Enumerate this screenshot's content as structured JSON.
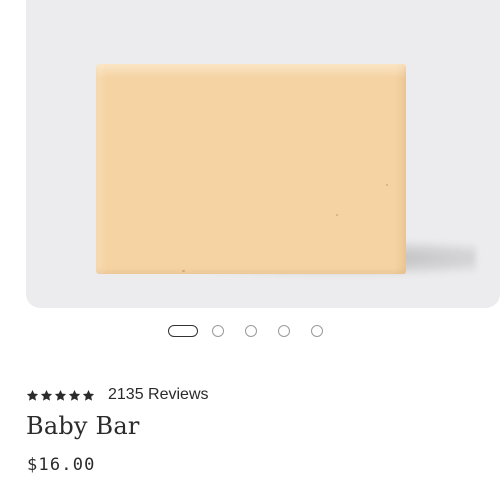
{
  "product": {
    "name": "Baby Bar",
    "price": "$16.00",
    "rating": 5,
    "reviews_label": "2135 Reviews",
    "image_subject": "soap-bar",
    "image_bg_color": "#ececee",
    "soap_color": "#f5d3a3"
  },
  "carousel": {
    "total_slides": 5,
    "active_index": 0
  },
  "icons": {
    "star": "star-icon"
  },
  "colors": {
    "text": "#2b2b2b",
    "dot_inactive": "#9a9a9a",
    "dot_active": "#333333"
  }
}
